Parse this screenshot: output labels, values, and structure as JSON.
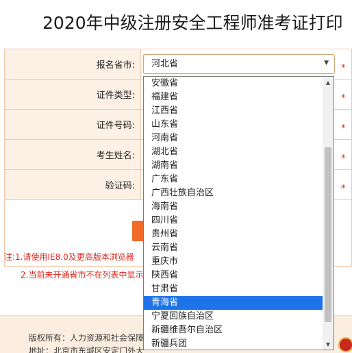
{
  "title": "2020年中级注册安全工程师准考证打印",
  "form": {
    "rows": [
      {
        "label": "报名省市:"
      },
      {
        "label": "证件类型:"
      },
      {
        "label": "证件号码:"
      },
      {
        "label": "考生姓名:"
      },
      {
        "label": "验证码:"
      }
    ],
    "required_mark": "*",
    "province_select": {
      "value": "河北省",
      "arrow": "▼"
    }
  },
  "notes": {
    "line1": "注:1.请使用IE8.0及更高版本浏览器",
    "line2": "2.当前未开通省市不在列表中显示"
  },
  "footer": {
    "copyright": "版权所有：人力资源和社会保障",
    "address": "地址：北京市东城区安定门外大"
  },
  "dropdown": {
    "options": [
      "安徽省",
      "福建省",
      "江西省",
      "山东省",
      "河南省",
      "湖北省",
      "湖南省",
      "广东省",
      "广西壮族自治区",
      "海南省",
      "四川省",
      "贵州省",
      "云南省",
      "重庆市",
      "陕西省",
      "甘肃省",
      "青海省",
      "宁夏回族自治区",
      "新疆维吾尔自治区",
      "新疆兵团"
    ],
    "highlighted": "青海省",
    "scroll_up": "▲",
    "scroll_down": "▼",
    "scroll_position": 0.78
  }
}
